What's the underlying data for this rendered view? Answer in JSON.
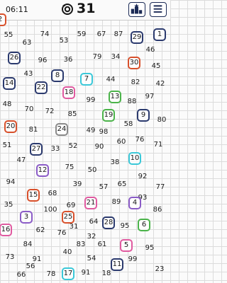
{
  "status": {
    "clock": "06:11",
    "count": "31"
  },
  "icons": {
    "timer": "timer-icon",
    "podium": "podium-icon",
    "menu": "hamburger-menu-icon"
  },
  "colors": {
    "dark_blue": "#2b3a6e",
    "red": "#d8502b",
    "green": "#4bb34a",
    "cyan": "#3ac8d8",
    "pink": "#e05aa0",
    "gray": "#8a8a8a",
    "purple": "#8b5cc7"
  },
  "numbers": [
    {
      "v": "55"
    },
    {
      "v": "74"
    },
    {
      "v": "59"
    },
    {
      "v": "67"
    },
    {
      "v": "87"
    },
    {
      "v": "29",
      "box": "dark_blue"
    },
    {
      "v": "1",
      "box": "dark_blue"
    },
    {
      "v": "63"
    },
    {
      "v": "53"
    },
    {
      "v": "46"
    },
    {
      "v": "26",
      "box": "dark_blue"
    },
    {
      "v": "96"
    },
    {
      "v": "36"
    },
    {
      "v": "79"
    },
    {
      "v": "34"
    },
    {
      "v": "30",
      "box": "red"
    },
    {
      "v": "45"
    },
    {
      "v": "43"
    },
    {
      "v": "8",
      "box": "dark_blue"
    },
    {
      "v": "7",
      "box": "cyan"
    },
    {
      "v": "44"
    },
    {
      "v": "14",
      "box": "dark_blue"
    },
    {
      "v": "22",
      "box": "dark_blue"
    },
    {
      "v": "82"
    },
    {
      "v": "42"
    },
    {
      "v": "18",
      "box": "pink"
    },
    {
      "v": "99"
    },
    {
      "v": "13",
      "box": "green"
    },
    {
      "v": "97"
    },
    {
      "v": "48"
    },
    {
      "v": "88"
    },
    {
      "v": "70"
    },
    {
      "v": "72"
    },
    {
      "v": "85"
    },
    {
      "v": "19",
      "box": "green"
    },
    {
      "v": "9",
      "box": "dark_blue"
    },
    {
      "v": "80"
    },
    {
      "v": "20",
      "box": "red"
    },
    {
      "v": "58"
    },
    {
      "v": "81"
    },
    {
      "v": "24",
      "box": "gray"
    },
    {
      "v": "49"
    },
    {
      "v": "98"
    },
    {
      "v": "76"
    },
    {
      "v": "51"
    },
    {
      "v": "27",
      "box": "dark_blue"
    },
    {
      "v": "33"
    },
    {
      "v": "52"
    },
    {
      "v": "90"
    },
    {
      "v": "60"
    },
    {
      "v": "71"
    },
    {
      "v": "47"
    },
    {
      "v": "38"
    },
    {
      "v": "10",
      "box": "cyan"
    },
    {
      "v": "12",
      "box": "purple"
    },
    {
      "v": "75"
    },
    {
      "v": "50"
    },
    {
      "v": "92"
    },
    {
      "v": "94"
    },
    {
      "v": "39"
    },
    {
      "v": "65"
    },
    {
      "v": "77"
    },
    {
      "v": "15",
      "box": "red"
    },
    {
      "v": "68"
    },
    {
      "v": "57"
    },
    {
      "v": "93"
    },
    {
      "v": "35"
    },
    {
      "v": "69"
    },
    {
      "v": "21",
      "box": "pink"
    },
    {
      "v": "89"
    },
    {
      "v": "4",
      "box": "purple"
    },
    {
      "v": "100"
    },
    {
      "v": "86"
    },
    {
      "v": "3",
      "box": "purple"
    },
    {
      "v": "25",
      "box": "red"
    },
    {
      "v": "64"
    },
    {
      "v": "28",
      "box": "dark_blue"
    },
    {
      "v": "95"
    },
    {
      "v": "6",
      "box": "green"
    },
    {
      "v": "16",
      "box": "pink"
    },
    {
      "v": "62"
    },
    {
      "v": "31"
    },
    {
      "v": "76"
    },
    {
      "v": "32"
    },
    {
      "v": "84"
    },
    {
      "v": "83"
    },
    {
      "v": "61"
    },
    {
      "v": "5",
      "box": "pink"
    },
    {
      "v": "73"
    },
    {
      "v": "91"
    },
    {
      "v": "40"
    },
    {
      "v": "95"
    },
    {
      "v": "56"
    },
    {
      "v": "54"
    },
    {
      "v": "99"
    },
    {
      "v": "11",
      "box": "dark_blue"
    },
    {
      "v": "66"
    },
    {
      "v": "78"
    },
    {
      "v": "17",
      "box": "cyan"
    },
    {
      "v": "91"
    },
    {
      "v": "18"
    },
    {
      "v": "23"
    },
    {
      "v": "2",
      "box": "red"
    }
  ]
}
